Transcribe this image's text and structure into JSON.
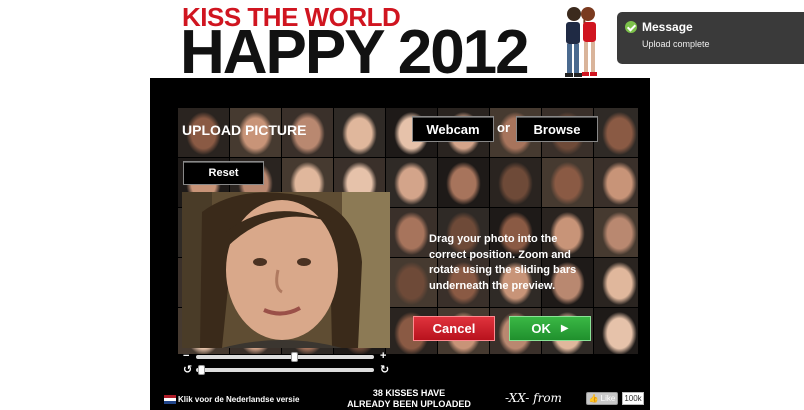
{
  "header": {
    "tagline": "KISS THE WORLD",
    "headline": "HAPPY 2012"
  },
  "toast": {
    "title": "Message",
    "body": "Upload complete",
    "icon": "check-circle-icon",
    "color": "#7dc24b"
  },
  "upload": {
    "title": "UPLOAD PICTURE",
    "webcam_label": "Webcam",
    "or_label": "or",
    "browse_label": "Browse",
    "reset_label": "Reset",
    "instructions": "Drag your photo into the correct position. Zoom and rotate using the sliding bars underneath the preview.",
    "cancel_label": "Cancel",
    "ok_label": "OK",
    "zoom_minus": "−",
    "zoom_plus": "+",
    "zoom_level": 0.55,
    "rotate_level": 0.03
  },
  "footer": {
    "language_link": "Klik voor de Nederlandse versie",
    "kisses_line1": "38 KISSES HAVE",
    "kisses_line2": "ALREADY BEEN UPLOADED",
    "signature": "-XX- from",
    "like_label": "Like",
    "like_count": "100k"
  },
  "colors": {
    "brand_red": "#d01520",
    "cancel_red": "#c8202a",
    "ok_green": "#2ea63a"
  }
}
